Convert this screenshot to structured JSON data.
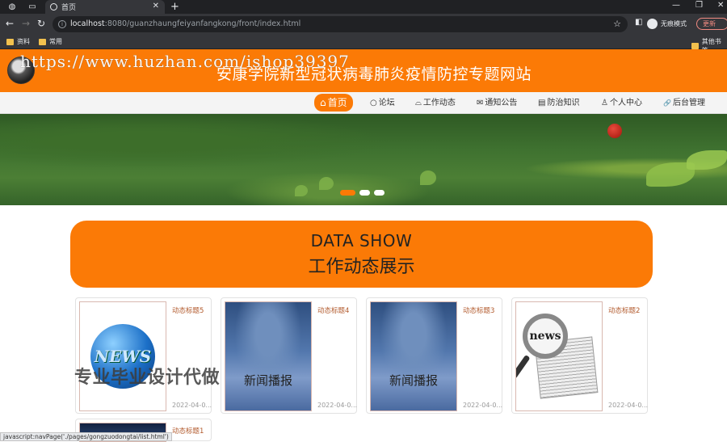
{
  "browser": {
    "tab_title": "首页",
    "url_host": "localhost",
    "url_rest": ":8080/guanzhaungfeiyanfangkong/front/index.html",
    "profile_label": "无痕模式",
    "update_label": "更新",
    "bookmarks": [
      "资料",
      "常用"
    ],
    "other_bookmarks": "其他书签"
  },
  "header": {
    "title": "安康学院新型冠状病毒肺炎疫情防控专题网站",
    "watermark_url": "https://www.huzhan.com/ishop39397"
  },
  "nav": {
    "items": [
      {
        "icon": "⌂",
        "label": "首页"
      },
      {
        "icon": "○",
        "label": "论坛"
      },
      {
        "icon": "⌓",
        "label": "工作动态"
      },
      {
        "icon": "✉",
        "label": "通知公告"
      },
      {
        "icon": "▤",
        "label": "防治知识"
      },
      {
        "icon": "♙",
        "label": "个人中心"
      },
      {
        "icon": "🔗",
        "label": "后台管理"
      }
    ]
  },
  "section": {
    "en": "DATA SHOW",
    "cn": "工作动态展示"
  },
  "cards": [
    {
      "title": "动态标题5",
      "date": "2022-04-0...",
      "thumb_text": "NEWS"
    },
    {
      "title": "动态标题4",
      "date": "2022-04-0...",
      "thumb_text": "新闻播报"
    },
    {
      "title": "动态标题3",
      "date": "2022-04-0...",
      "thumb_text": "新闻播报"
    },
    {
      "title": "动态标题2",
      "date": "2022-04-0...",
      "thumb_text": "news"
    },
    {
      "title": "动态标题1",
      "date": "",
      "thumb_text": ""
    }
  ],
  "watermark_cn": "专业毕业设计代做",
  "status_text": "javascript:navPage('./pages/gongzuodongtai/list.html')",
  "colors": {
    "accent": "#fb7a06",
    "chrome_dark": "#202124"
  }
}
